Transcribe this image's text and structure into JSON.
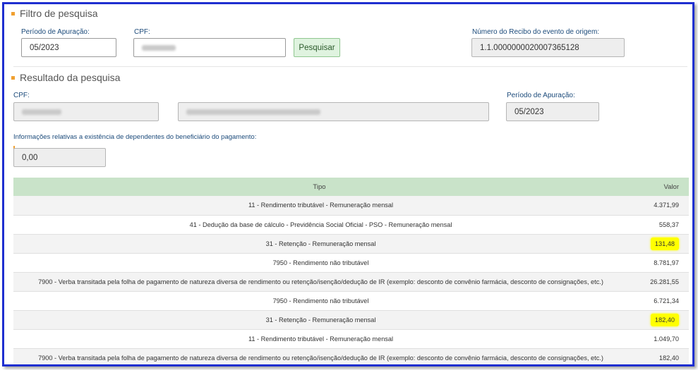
{
  "filter": {
    "title": "Filtro de pesquisa",
    "periodo_label": "Período de Apuração:",
    "periodo_value": "05/2023",
    "cpf_label": "CPF:",
    "search_button": "Pesquisar",
    "recibo_label": "Número do Recibo do evento de origem:",
    "recibo_value": "1.1.0000000020007365128"
  },
  "result": {
    "title": "Resultado da pesquisa",
    "cpf_label": "CPF:",
    "periodo_label": "Período de Apuração:",
    "periodo_value": "05/2023",
    "dependentes_label": "Informações relativas a existência de dependentes do beneficiário do pagamento:",
    "dependentes_value": "0,00"
  },
  "table": {
    "headers": {
      "tipo": "Tipo",
      "valor": "Valor"
    },
    "highlight_color": "#ffff00",
    "rows": [
      {
        "tipo": "11 - Rendimento tributável - Remuneração mensal",
        "valor": "4.371,99",
        "highlight": false
      },
      {
        "tipo": "41 - Dedução da base de cálculo - Previdência Social Oficial - PSO - Remuneração mensal",
        "valor": "558,37",
        "highlight": false
      },
      {
        "tipo": "31 - Retenção - Remuneração mensal",
        "valor": "131,48",
        "highlight": true
      },
      {
        "tipo": "7950 - Rendimento não tributável",
        "valor": "8.781,97",
        "highlight": false
      },
      {
        "tipo": "7900 - Verba transitada pela folha de pagamento de natureza diversa de rendimento ou retenção/isenção/dedução de IR (exemplo: desconto de convênio farmácia, desconto de consignações, etc.)",
        "valor": "26.281,55",
        "highlight": false
      },
      {
        "tipo": "7950 - Rendimento não tributável",
        "valor": "6.721,34",
        "highlight": false
      },
      {
        "tipo": "31 - Retenção - Remuneração mensal",
        "valor": "182,40",
        "highlight": true
      },
      {
        "tipo": "11 - Rendimento tributável - Remuneração mensal",
        "valor": "1.049,70",
        "highlight": false
      },
      {
        "tipo": "7900 - Verba transitada pela folha de pagamento de natureza diversa de rendimento ou retenção/isenção/dedução de IR (exemplo: desconto de convênio farmácia, desconto de consignações, etc.)",
        "valor": "182,40",
        "highlight": false
      }
    ]
  }
}
